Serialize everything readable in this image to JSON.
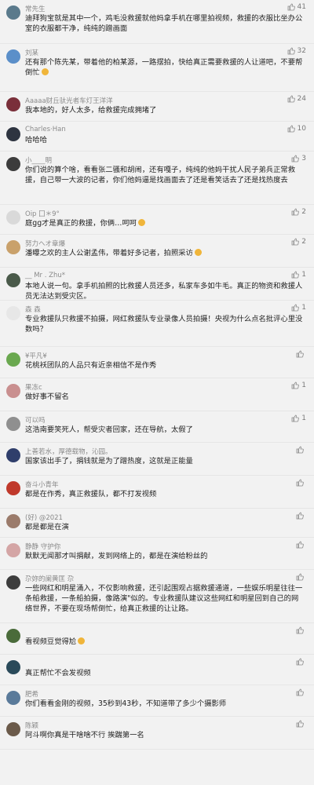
{
  "comments": [
    {
      "user": "常先生",
      "likes": "41",
      "text": "迪拜狗宝就是其中一个，鸡毛没救援就他妈拿手机在哪里拍视频，救援的衣服比坐办公室的衣服都干净，纯纯的蹭画面",
      "avatar_color": "#5a7a8c"
    },
    {
      "user": "刘某",
      "likes": "32",
      "text": "还有那个陈先某，带着他的柏某源，一路摆拍，快给真正需要救援的人让道吧，不要帮倒忙",
      "avatar_color": "#5b8fc9",
      "emoji": true
    },
    {
      "user": "Aaaaa财丘驮光者车灯王洋洋",
      "likes": "24",
      "text": "我本地的，好人太多，给救援完成拥堵了",
      "avatar_color": "#7a2f3a"
    },
    {
      "user": "Charles·Han",
      "likes": "10",
      "text": "哈哈哈",
      "avatar_color": "#2e3440"
    },
    {
      "user": "小____明",
      "likes": "3",
      "text": "你们说的算个啥，看看张二骚和胡闹，还有嘎子，纯纯的他妈干扰人民子弟兵正常救援，自己带一大波的记者，你们他妈逼是找画面去了还是看笑话去了还是找热度去",
      "avatar_color": "#3c3c3c"
    },
    {
      "user": "Oip 囗＊9°",
      "likes": "2",
      "text": "庭gg才是真正的救援，你俩…呵呵",
      "avatar_color": "#d9d9d9",
      "emoji": true
    },
    {
      "user": "努力ヘオ章爆",
      "likes": "2",
      "text": "潘曝之欢的主人公谢孟伟，带着好多记者，拍照采访",
      "avatar_color": "#c9a16b",
      "emoji": true
    },
    {
      "user": "__ Mr . Zhu*",
      "likes": "1",
      "text": "本地人说一句。拿手机拍照的比救援人员还多，私家车多如牛毛。真正的物资和救援人员无法达到受灾区。",
      "avatar_color": "#4a5a4a"
    },
    {
      "user": "森 森",
      "likes": "1",
      "text": "专业救援队只救援不拍摄，网红救援队专业录像人员拍摄！央视为什么点名批评心里没数吗？",
      "avatar_color": "#e7e7e7"
    },
    {
      "user": "¥平凡¥",
      "likes": "",
      "text": "花桃袄团队的人品只有近亲相信不是作秀",
      "avatar_color": "#6aa84f"
    },
    {
      "user": "果冻c",
      "likes": "1",
      "text": "做好事不留名",
      "avatar_color": "#c98f8f"
    },
    {
      "user": "可以吗",
      "likes": "1",
      "text": "这浩南要笑死人，帮受灾者回家，还在导航，太假了",
      "avatar_color": "#8f8f8f"
    },
    {
      "user": "上善若水，厚德载物，沁园。",
      "likes": "",
      "text": "国家该出手了，捐钱就是为了蹭热度，这就是正能量",
      "avatar_color": "#2f3e6b"
    },
    {
      "user": "奋斗小青年",
      "likes": "",
      "text": "都是在作秀，真正救援队，都不打发视频",
      "avatar_color": "#c0392b"
    },
    {
      "user": "(好) @2021",
      "likes": "",
      "text": "都是都是在演",
      "avatar_color": "#9b7b6b"
    },
    {
      "user": "静静 守护你",
      "likes": "",
      "text": "默默无闻那才叫捐献，发到网络上的，都是在演给粉丝的",
      "avatar_color": "#d4a5a5"
    },
    {
      "user": "尕妳的阑黄匡 尕",
      "likes": "",
      "text": "一些网红和明星涌入，不仅影响救援，还引起围观占据救援通道，一些娱乐明星往往一条船救援，一条船拍摄，像路演\"似的。专业救援队建议这些网红和明星回到自己的网络世界，不要在现场帮倒忙，给真正救援的让让路。",
      "avatar_color": "#3d3d3d"
    },
    {
      "user": "",
      "likes": "",
      "text": "看视频豆觉得尬",
      "avatar_color": "#4a6b3a",
      "emoji": true
    },
    {
      "user": "",
      "likes": "",
      "text": "真正帮忙不会发视频",
      "avatar_color": "#2a4a5a"
    },
    {
      "user": "肥希",
      "likes": "",
      "text": "你们看看金刚的视频，35秒到43秒，不知道带了多少个摄影师",
      "avatar_color": "#5a7a9a"
    },
    {
      "user": "陈颖",
      "likes": "",
      "text": "阿斗啊你真是干啥啥不行 挨踹第一名",
      "avatar_color": "#6b5a4a"
    }
  ]
}
